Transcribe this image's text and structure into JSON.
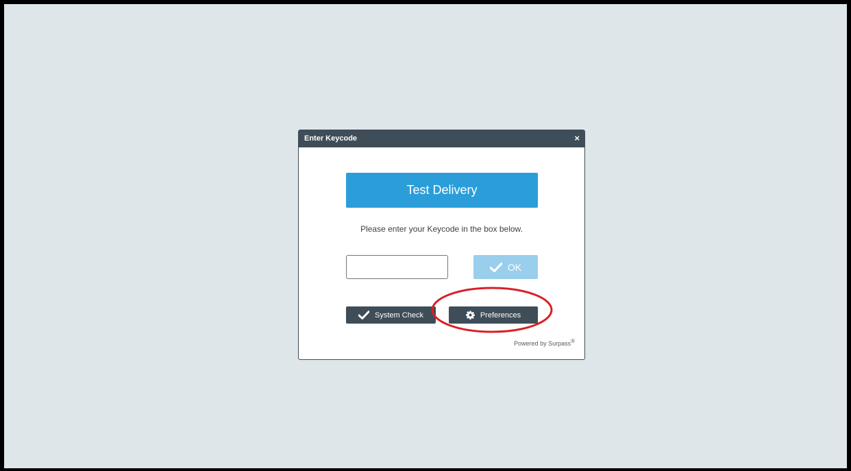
{
  "dialog": {
    "title": "Enter Keycode",
    "close_label": "×",
    "banner_label": "Test Delivery",
    "instruction": "Please enter your Keycode in the box below.",
    "keycode_input": {
      "value": "",
      "placeholder": ""
    },
    "ok_label": "OK",
    "system_check_label": "System Check",
    "preferences_label": "Preferences",
    "powered_by": "Powered by Surpass",
    "powered_mark": "®"
  },
  "icons": {
    "ok": "check-icon",
    "system_check": "check-icon",
    "preferences": "gear-icon"
  },
  "colors": {
    "background": "#dfe6e9",
    "titlebar": "#3e4d57",
    "banner": "#2b9ed9",
    "ok_disabled": "#99cfec",
    "highlight": "#d91f26"
  }
}
